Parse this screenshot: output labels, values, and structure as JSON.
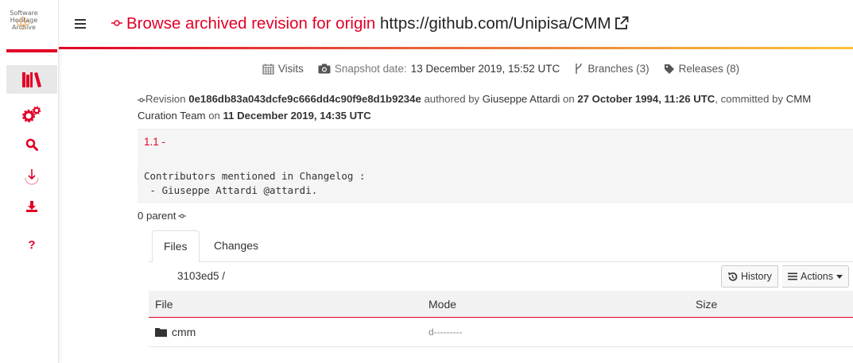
{
  "logo": {
    "line1": "Software",
    "line2": "Heritage",
    "line3": "Archive"
  },
  "sidebar": {
    "items": [
      {
        "icon": "library-icon",
        "active": true
      },
      {
        "icon": "gears-icon"
      },
      {
        "icon": "search-icon"
      },
      {
        "icon": "save-code-now-icon"
      },
      {
        "icon": "download-icon"
      },
      {
        "icon": "help-icon"
      }
    ]
  },
  "header": {
    "title_prefix": "Browse archived revision for origin",
    "origin_url": "https://github.com/Unipisa/CMM"
  },
  "stats": {
    "visits": "Visits",
    "snapshot_label": "Snapshot date:",
    "snapshot_date": "13 December 2019, 15:52 UTC",
    "branches": "Branches (3)",
    "releases": "Releases (8)"
  },
  "revision": {
    "label": "Revision",
    "id": "0e186db83a043dcfe9c666dd4c90f9e8d1b9234e",
    "authored_by": "authored by",
    "author": "Giuseppe Attardi",
    "on1": "on",
    "authored_date": "27 October 1994, 11:26 UTC",
    "committed_by": ", committed by",
    "committer": "CMM Curation Team",
    "on2": "on",
    "committed_date": "11 December 2019, 14:35 UTC"
  },
  "message": {
    "version": "1.1 -",
    "line1": "Contributors mentioned in Changelog :",
    "line2": " - Giuseppe Attardi @attardi."
  },
  "parents": {
    "label": "0 parent"
  },
  "tabs": [
    {
      "label": "Files"
    },
    {
      "label": "Changes"
    }
  ],
  "path": "3103ed5 /",
  "buttons": {
    "history": "History",
    "actions": "Actions"
  },
  "table": {
    "headers": [
      "File",
      "Mode",
      "Size"
    ],
    "rows": [
      {
        "name": "cmm",
        "mode": "d---------",
        "size": ""
      }
    ]
  },
  "colors": {
    "accent": "#e20026",
    "gradient_end": "#fdc13a"
  }
}
